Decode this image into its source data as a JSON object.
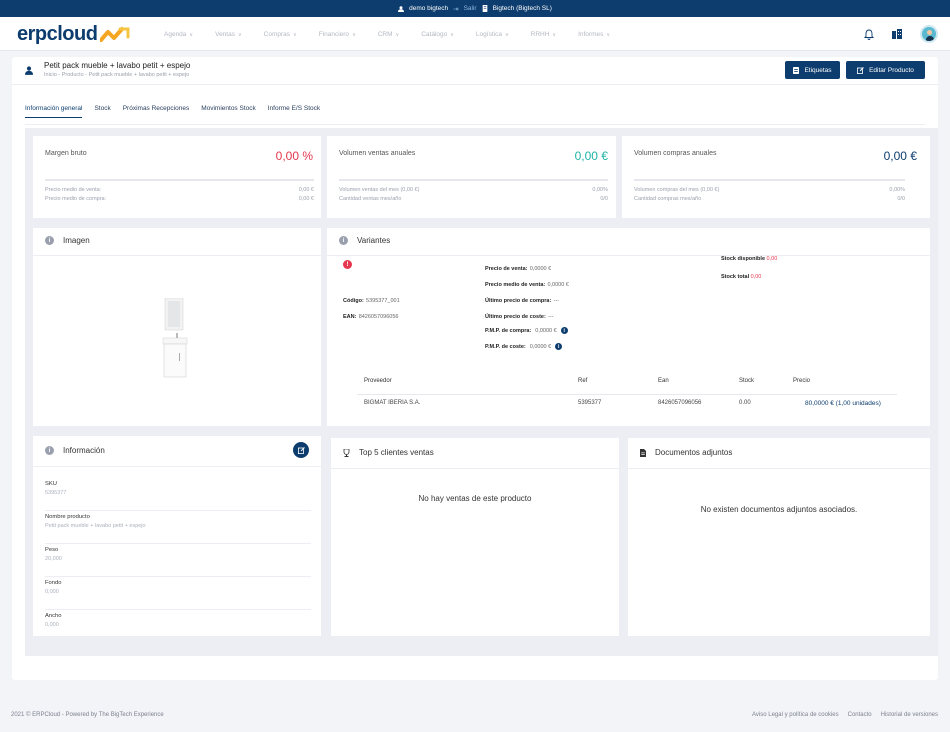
{
  "topbar": {
    "user": "demo bigtech",
    "logout": "Salir",
    "company": "Bigtech (Bigtech SL)"
  },
  "brand": {
    "name": "erpcloud"
  },
  "menu": [
    "Agenda",
    "Ventas",
    "Compras",
    "Financiero",
    "CRM",
    "Catálogo",
    "Logística",
    "RRHH",
    "Informes"
  ],
  "page": {
    "title": "Petit pack mueble + lavabo petit + espejo",
    "breadcrumb": "Inicio - Producto - Petit pack mueble + lavabo petit + espejo",
    "btn_labels": "Etiquetas",
    "btn_edit": "Editar Producto"
  },
  "tabs": [
    "Información general",
    "Stock",
    "Próximas Recepciones",
    "Movimientos Stock",
    "Informe E/S Stock"
  ],
  "kpi": [
    {
      "label": "Margen bruto",
      "value": "0,00 %",
      "color": "#e5374d",
      "rows": [
        [
          "Precio medio de venta:",
          "0,00 €"
        ],
        [
          "Precio medio de compra:",
          "0,00 €"
        ]
      ]
    },
    {
      "label": "Volumen ventas anuales",
      "value": "0,00 €",
      "color": "#1fb5a8",
      "rows": [
        [
          "Volumen ventas del mes (0,00 €)",
          "0,00%"
        ],
        [
          "Cantidad ventas mes/año",
          "0/0"
        ]
      ]
    },
    {
      "label": "Volumen compras anuales",
      "value": "0,00 €",
      "color": "#0d3d6e",
      "rows": [
        [
          "Volumen compras del mes (0,00 €)",
          "0,00%"
        ],
        [
          "Cantidad compras mes/año",
          "0/0"
        ]
      ]
    }
  ],
  "imagen": {
    "title": "Imagen"
  },
  "variantes": {
    "title": "Variantes",
    "codigo_label": "Código:",
    "codigo": "5395377_001",
    "ean_label": "EAN:",
    "ean": "8426057096056",
    "prices": [
      [
        "Precio de venta:",
        "0,0000 €"
      ],
      [
        "Precio medio de venta:",
        "0,0000 €"
      ],
      [
        "Último precio de compra:",
        "---"
      ],
      [
        "Último precio de coste:",
        "---"
      ],
      [
        "P.M.P. de compra:",
        "0,0000 €"
      ],
      [
        "P.M.P. de coste:",
        "0,0000 €"
      ]
    ],
    "stock_disp_label": "Stock disponible",
    "stock_disp": "0,00",
    "stock_total_label": "Stock total",
    "stock_total": "0,00",
    "table": {
      "headers": [
        "Proveedor",
        "Ref",
        "Ean",
        "Stock",
        "Precio"
      ],
      "rows": [
        [
          "BIGMAT IBERIA S.A.",
          "5395377",
          "8426057096056",
          "0.00",
          "80,0000 € (1,00 unidades)"
        ]
      ]
    }
  },
  "informacion": {
    "title": "Información",
    "fields": [
      [
        "SKU",
        "5395377"
      ],
      [
        "Nombre producto",
        "Petit pack mueble + lavabo petit + espejo"
      ],
      [
        "Peso",
        "20,000"
      ],
      [
        "Fondo",
        "0,000"
      ],
      [
        "Ancho",
        "0,000"
      ]
    ]
  },
  "top5": {
    "title": "Top 5 clientes ventas",
    "empty": "No hay ventas de este producto"
  },
  "docs": {
    "title": "Documentos adjuntos",
    "empty": "No existen documentos adjuntos asociados."
  },
  "footer": {
    "copyright": "2021 © ERPCloud - Powered by The BigTech Experience",
    "links": [
      "Aviso Legal y política de cookies",
      "Contacto",
      "Historial de versiones"
    ]
  }
}
